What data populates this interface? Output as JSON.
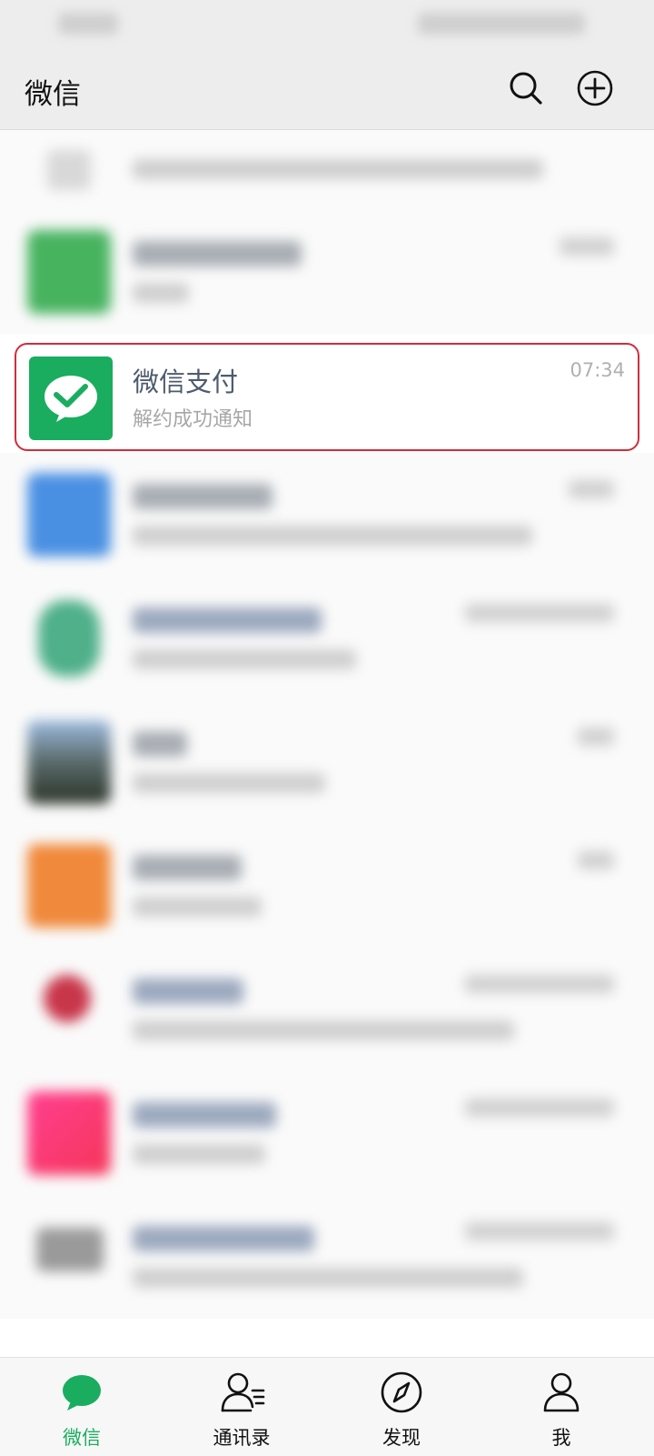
{
  "header": {
    "title": "微信",
    "search_icon": "search-icon",
    "add_icon": "plus-circle-icon"
  },
  "highlighted_chat": {
    "name": "微信支付",
    "last_message": "解约成功通知",
    "time": "07:34",
    "avatar_icon": "wechat-pay-icon"
  },
  "tabs": [
    {
      "label": "微信",
      "icon": "chat-bubble-icon",
      "active": true
    },
    {
      "label": "通讯录",
      "icon": "contacts-icon",
      "active": false
    },
    {
      "label": "发现",
      "icon": "compass-icon",
      "active": false
    },
    {
      "label": "我",
      "icon": "person-icon",
      "active": false
    }
  ],
  "colors": {
    "accent_green": "#1aad5f",
    "highlight_border": "#d02d3c",
    "header_bg": "#ededed"
  }
}
